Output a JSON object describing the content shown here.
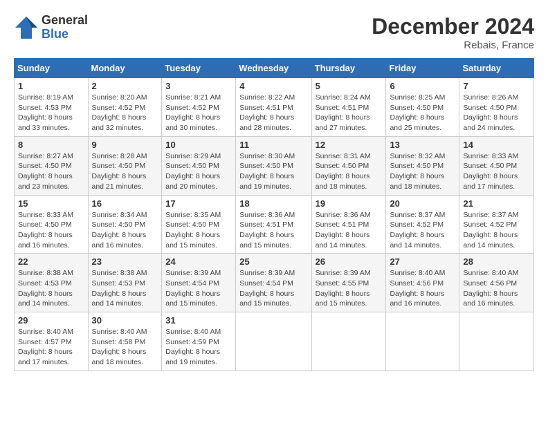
{
  "header": {
    "logo_general": "General",
    "logo_blue": "Blue",
    "month_title": "December 2024",
    "location": "Rebais, France"
  },
  "weekdays": [
    "Sunday",
    "Monday",
    "Tuesday",
    "Wednesday",
    "Thursday",
    "Friday",
    "Saturday"
  ],
  "weeks": [
    [
      {
        "day": "1",
        "sunrise": "Sunrise: 8:19 AM",
        "sunset": "Sunset: 4:53 PM",
        "daylight": "Daylight: 8 hours and 33 minutes."
      },
      {
        "day": "2",
        "sunrise": "Sunrise: 8:20 AM",
        "sunset": "Sunset: 4:52 PM",
        "daylight": "Daylight: 8 hours and 32 minutes."
      },
      {
        "day": "3",
        "sunrise": "Sunrise: 8:21 AM",
        "sunset": "Sunset: 4:52 PM",
        "daylight": "Daylight: 8 hours and 30 minutes."
      },
      {
        "day": "4",
        "sunrise": "Sunrise: 8:22 AM",
        "sunset": "Sunset: 4:51 PM",
        "daylight": "Daylight: 8 hours and 28 minutes."
      },
      {
        "day": "5",
        "sunrise": "Sunrise: 8:24 AM",
        "sunset": "Sunset: 4:51 PM",
        "daylight": "Daylight: 8 hours and 27 minutes."
      },
      {
        "day": "6",
        "sunrise": "Sunrise: 8:25 AM",
        "sunset": "Sunset: 4:50 PM",
        "daylight": "Daylight: 8 hours and 25 minutes."
      },
      {
        "day": "7",
        "sunrise": "Sunrise: 8:26 AM",
        "sunset": "Sunset: 4:50 PM",
        "daylight": "Daylight: 8 hours and 24 minutes."
      }
    ],
    [
      {
        "day": "8",
        "sunrise": "Sunrise: 8:27 AM",
        "sunset": "Sunset: 4:50 PM",
        "daylight": "Daylight: 8 hours and 23 minutes."
      },
      {
        "day": "9",
        "sunrise": "Sunrise: 8:28 AM",
        "sunset": "Sunset: 4:50 PM",
        "daylight": "Daylight: 8 hours and 21 minutes."
      },
      {
        "day": "10",
        "sunrise": "Sunrise: 8:29 AM",
        "sunset": "Sunset: 4:50 PM",
        "daylight": "Daylight: 8 hours and 20 minutes."
      },
      {
        "day": "11",
        "sunrise": "Sunrise: 8:30 AM",
        "sunset": "Sunset: 4:50 PM",
        "daylight": "Daylight: 8 hours and 19 minutes."
      },
      {
        "day": "12",
        "sunrise": "Sunrise: 8:31 AM",
        "sunset": "Sunset: 4:50 PM",
        "daylight": "Daylight: 8 hours and 18 minutes."
      },
      {
        "day": "13",
        "sunrise": "Sunrise: 8:32 AM",
        "sunset": "Sunset: 4:50 PM",
        "daylight": "Daylight: 8 hours and 18 minutes."
      },
      {
        "day": "14",
        "sunrise": "Sunrise: 8:33 AM",
        "sunset": "Sunset: 4:50 PM",
        "daylight": "Daylight: 8 hours and 17 minutes."
      }
    ],
    [
      {
        "day": "15",
        "sunrise": "Sunrise: 8:33 AM",
        "sunset": "Sunset: 4:50 PM",
        "daylight": "Daylight: 8 hours and 16 minutes."
      },
      {
        "day": "16",
        "sunrise": "Sunrise: 8:34 AM",
        "sunset": "Sunset: 4:50 PM",
        "daylight": "Daylight: 8 hours and 16 minutes."
      },
      {
        "day": "17",
        "sunrise": "Sunrise: 8:35 AM",
        "sunset": "Sunset: 4:50 PM",
        "daylight": "Daylight: 8 hours and 15 minutes."
      },
      {
        "day": "18",
        "sunrise": "Sunrise: 8:36 AM",
        "sunset": "Sunset: 4:51 PM",
        "daylight": "Daylight: 8 hours and 15 minutes."
      },
      {
        "day": "19",
        "sunrise": "Sunrise: 8:36 AM",
        "sunset": "Sunset: 4:51 PM",
        "daylight": "Daylight: 8 hours and 14 minutes."
      },
      {
        "day": "20",
        "sunrise": "Sunrise: 8:37 AM",
        "sunset": "Sunset: 4:52 PM",
        "daylight": "Daylight: 8 hours and 14 minutes."
      },
      {
        "day": "21",
        "sunrise": "Sunrise: 8:37 AM",
        "sunset": "Sunset: 4:52 PM",
        "daylight": "Daylight: 8 hours and 14 minutes."
      }
    ],
    [
      {
        "day": "22",
        "sunrise": "Sunrise: 8:38 AM",
        "sunset": "Sunset: 4:53 PM",
        "daylight": "Daylight: 8 hours and 14 minutes."
      },
      {
        "day": "23",
        "sunrise": "Sunrise: 8:38 AM",
        "sunset": "Sunset: 4:53 PM",
        "daylight": "Daylight: 8 hours and 14 minutes."
      },
      {
        "day": "24",
        "sunrise": "Sunrise: 8:39 AM",
        "sunset": "Sunset: 4:54 PM",
        "daylight": "Daylight: 8 hours and 15 minutes."
      },
      {
        "day": "25",
        "sunrise": "Sunrise: 8:39 AM",
        "sunset": "Sunset: 4:54 PM",
        "daylight": "Daylight: 8 hours and 15 minutes."
      },
      {
        "day": "26",
        "sunrise": "Sunrise: 8:39 AM",
        "sunset": "Sunset: 4:55 PM",
        "daylight": "Daylight: 8 hours and 15 minutes."
      },
      {
        "day": "27",
        "sunrise": "Sunrise: 8:40 AM",
        "sunset": "Sunset: 4:56 PM",
        "daylight": "Daylight: 8 hours and 16 minutes."
      },
      {
        "day": "28",
        "sunrise": "Sunrise: 8:40 AM",
        "sunset": "Sunset: 4:56 PM",
        "daylight": "Daylight: 8 hours and 16 minutes."
      }
    ],
    [
      {
        "day": "29",
        "sunrise": "Sunrise: 8:40 AM",
        "sunset": "Sunset: 4:57 PM",
        "daylight": "Daylight: 8 hours and 17 minutes."
      },
      {
        "day": "30",
        "sunrise": "Sunrise: 8:40 AM",
        "sunset": "Sunset: 4:58 PM",
        "daylight": "Daylight: 8 hours and 18 minutes."
      },
      {
        "day": "31",
        "sunrise": "Sunrise: 8:40 AM",
        "sunset": "Sunset: 4:59 PM",
        "daylight": "Daylight: 8 hours and 19 minutes."
      },
      null,
      null,
      null,
      null
    ]
  ]
}
